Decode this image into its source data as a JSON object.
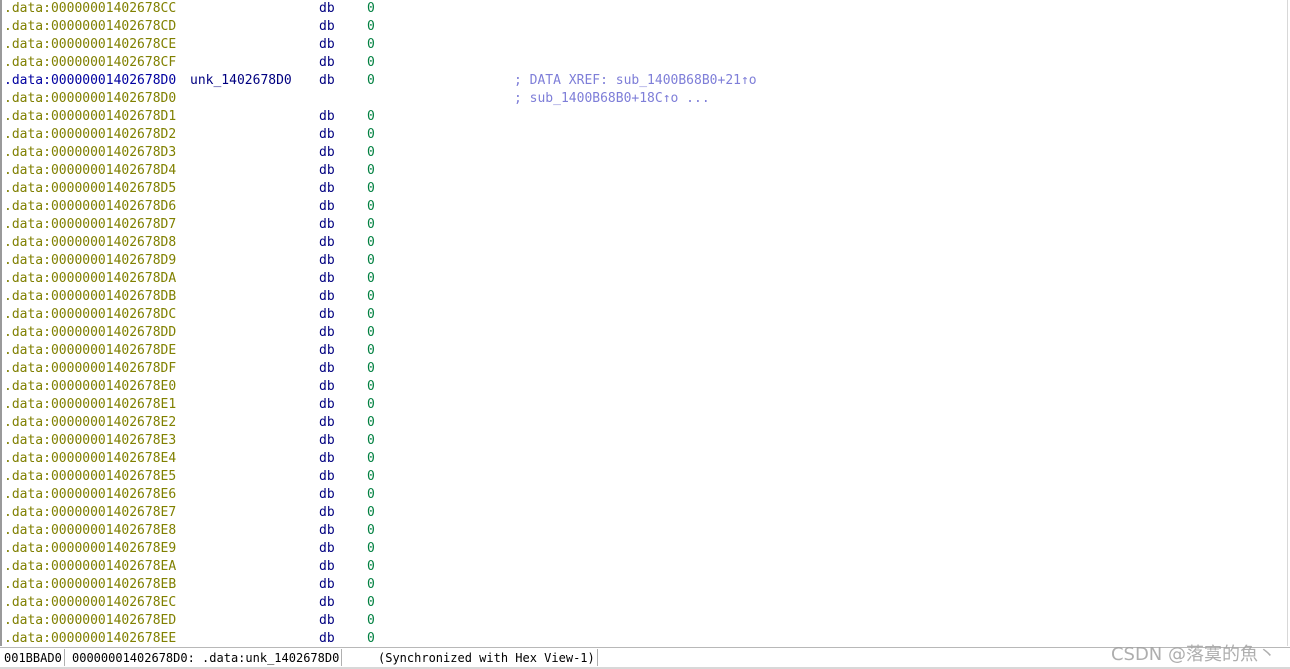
{
  "listing": {
    "lines": [
      {
        "addr": ".data:00000001402678CC",
        "label": "",
        "mnem": "db",
        "opnd": "0",
        "cmt": ""
      },
      {
        "addr": ".data:00000001402678CD",
        "label": "",
        "mnem": "db",
        "opnd": "0",
        "cmt": ""
      },
      {
        "addr": ".data:00000001402678CE",
        "label": "",
        "mnem": "db",
        "opnd": "0",
        "cmt": ""
      },
      {
        "addr": ".data:00000001402678CF",
        "label": "",
        "mnem": "db",
        "opnd": "0",
        "cmt": ""
      },
      {
        "addr": ".data:00000001402678D0",
        "label": "unk_1402678D0",
        "mnem": "db",
        "opnd": "0",
        "cmt": "; DATA XREF: sub_1400B68B0+21↑o",
        "selected": true
      },
      {
        "addr": ".data:00000001402678D0",
        "label": "",
        "mnem": "",
        "opnd": "",
        "cmt": "; sub_1400B68B0+18C↑o ..."
      },
      {
        "addr": ".data:00000001402678D1",
        "label": "",
        "mnem": "db",
        "opnd": "0",
        "cmt": ""
      },
      {
        "addr": ".data:00000001402678D2",
        "label": "",
        "mnem": "db",
        "opnd": "0",
        "cmt": ""
      },
      {
        "addr": ".data:00000001402678D3",
        "label": "",
        "mnem": "db",
        "opnd": "0",
        "cmt": ""
      },
      {
        "addr": ".data:00000001402678D4",
        "label": "",
        "mnem": "db",
        "opnd": "0",
        "cmt": ""
      },
      {
        "addr": ".data:00000001402678D5",
        "label": "",
        "mnem": "db",
        "opnd": "0",
        "cmt": ""
      },
      {
        "addr": ".data:00000001402678D6",
        "label": "",
        "mnem": "db",
        "opnd": "0",
        "cmt": ""
      },
      {
        "addr": ".data:00000001402678D7",
        "label": "",
        "mnem": "db",
        "opnd": "0",
        "cmt": ""
      },
      {
        "addr": ".data:00000001402678D8",
        "label": "",
        "mnem": "db",
        "opnd": "0",
        "cmt": ""
      },
      {
        "addr": ".data:00000001402678D9",
        "label": "",
        "mnem": "db",
        "opnd": "0",
        "cmt": ""
      },
      {
        "addr": ".data:00000001402678DA",
        "label": "",
        "mnem": "db",
        "opnd": "0",
        "cmt": ""
      },
      {
        "addr": ".data:00000001402678DB",
        "label": "",
        "mnem": "db",
        "opnd": "0",
        "cmt": ""
      },
      {
        "addr": ".data:00000001402678DC",
        "label": "",
        "mnem": "db",
        "opnd": "0",
        "cmt": ""
      },
      {
        "addr": ".data:00000001402678DD",
        "label": "",
        "mnem": "db",
        "opnd": "0",
        "cmt": ""
      },
      {
        "addr": ".data:00000001402678DE",
        "label": "",
        "mnem": "db",
        "opnd": "0",
        "cmt": ""
      },
      {
        "addr": ".data:00000001402678DF",
        "label": "",
        "mnem": "db",
        "opnd": "0",
        "cmt": ""
      },
      {
        "addr": ".data:00000001402678E0",
        "label": "",
        "mnem": "db",
        "opnd": "0",
        "cmt": ""
      },
      {
        "addr": ".data:00000001402678E1",
        "label": "",
        "mnem": "db",
        "opnd": "0",
        "cmt": ""
      },
      {
        "addr": ".data:00000001402678E2",
        "label": "",
        "mnem": "db",
        "opnd": "0",
        "cmt": ""
      },
      {
        "addr": ".data:00000001402678E3",
        "label": "",
        "mnem": "db",
        "opnd": "0",
        "cmt": ""
      },
      {
        "addr": ".data:00000001402678E4",
        "label": "",
        "mnem": "db",
        "opnd": "0",
        "cmt": ""
      },
      {
        "addr": ".data:00000001402678E5",
        "label": "",
        "mnem": "db",
        "opnd": "0",
        "cmt": ""
      },
      {
        "addr": ".data:00000001402678E6",
        "label": "",
        "mnem": "db",
        "opnd": "0",
        "cmt": ""
      },
      {
        "addr": ".data:00000001402678E7",
        "label": "",
        "mnem": "db",
        "opnd": "0",
        "cmt": ""
      },
      {
        "addr": ".data:00000001402678E8",
        "label": "",
        "mnem": "db",
        "opnd": "0",
        "cmt": ""
      },
      {
        "addr": ".data:00000001402678E9",
        "label": "",
        "mnem": "db",
        "opnd": "0",
        "cmt": ""
      },
      {
        "addr": ".data:00000001402678EA",
        "label": "",
        "mnem": "db",
        "opnd": "0",
        "cmt": ""
      },
      {
        "addr": ".data:00000001402678EB",
        "label": "",
        "mnem": "db",
        "opnd": "0",
        "cmt": ""
      },
      {
        "addr": ".data:00000001402678EC",
        "label": "",
        "mnem": "db",
        "opnd": "0",
        "cmt": ""
      },
      {
        "addr": ".data:00000001402678ED",
        "label": "",
        "mnem": "db",
        "opnd": "0",
        "cmt": ""
      },
      {
        "addr": ".data:00000001402678EE",
        "label": "",
        "mnem": "db",
        "opnd": "0",
        "cmt": ""
      }
    ]
  },
  "statusbar": {
    "offset": "001BBAD0",
    "location": "00000001402678D0: .data:unk_1402678D0",
    "sync": "(Synchronized with Hex View-1)"
  },
  "watermark": "CSDN @落寞的魚丶",
  "colors": {
    "address": "#808000",
    "selected_address": "#0000a0",
    "mnemonic": "#000080",
    "operand": "#008040",
    "comment": "#7e7ed8"
  }
}
